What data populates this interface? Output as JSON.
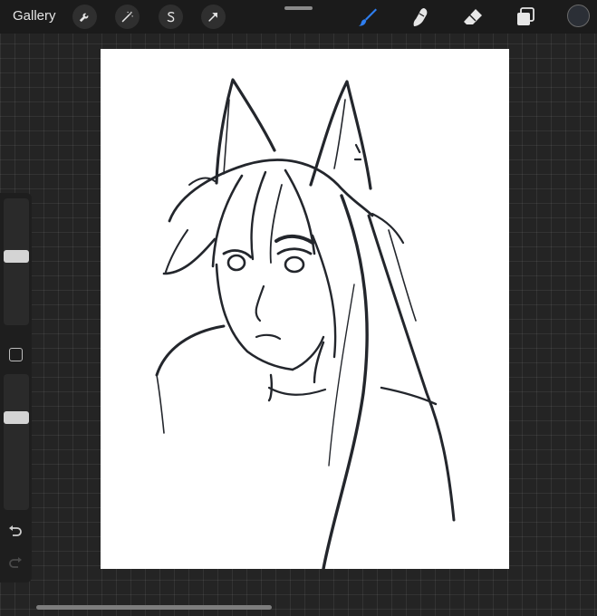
{
  "toolbar": {
    "gallery_label": "Gallery",
    "left_tools": [
      {
        "name": "actions",
        "icon": "wrench-icon"
      },
      {
        "name": "adjustments",
        "icon": "magic-wand-icon"
      },
      {
        "name": "selection",
        "icon": "selection-s-icon"
      },
      {
        "name": "transform",
        "icon": "arrow-cursor-icon"
      }
    ],
    "right_tools": [
      {
        "name": "brush",
        "icon": "brush-icon",
        "active": true
      },
      {
        "name": "smudge",
        "icon": "smudge-finger-icon",
        "active": false
      },
      {
        "name": "eraser",
        "icon": "eraser-icon",
        "active": false
      },
      {
        "name": "layers",
        "icon": "layers-icon",
        "active": false
      }
    ],
    "current_color": "#2b2f36"
  },
  "sidebar": {
    "brush_size_level": 0.55,
    "opacity_level": 0.7,
    "modify_icon": "square-icon",
    "undo_icon": "undo-arrow-icon",
    "redo_icon": "redo-arrow-icon"
  },
  "colors": {
    "accent": "#2f7ff0",
    "ink": "#23262c"
  },
  "canvas": {
    "content": "line-art-sketch"
  }
}
